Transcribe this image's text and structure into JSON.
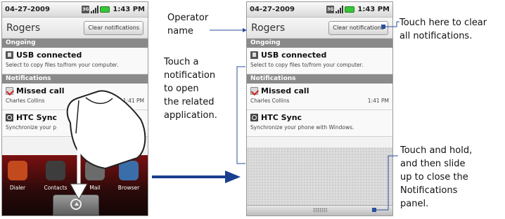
{
  "screens": {
    "status": {
      "date": "04-27-2009",
      "time": "1:43 PM",
      "net_badge": "3G"
    },
    "operator": "Rogers",
    "clear_button_left": "Clear notifications",
    "clear_button_right": "Clear notifications",
    "sections": {
      "ongoing": "Ongoing",
      "notifications": "Notifications"
    },
    "usb": {
      "title": "USB connected",
      "subtitle": "Select to copy files to/from your computer."
    },
    "missed": {
      "title": "Missed call",
      "caller": "Charles Collins",
      "time": "1:41 PM"
    },
    "htc_left": {
      "title": "HTC Sync",
      "subtitle": "Synchronize your p"
    },
    "htc_right": {
      "title": "HTC Sync",
      "subtitle": "Synchronize your phone with Windows."
    },
    "home_apps": [
      "Dialer",
      "Contacts",
      "Mail",
      "Browser"
    ]
  },
  "annotations": {
    "operator": [
      "Operator",
      "name"
    ],
    "touch_notification": [
      "Touch a",
      "notification",
      "to open",
      "the related",
      "application."
    ],
    "clear_all": [
      "Touch here to clear",
      "all notifications."
    ],
    "slide_close": [
      "Touch and hold,",
      "and then slide",
      "up to close the",
      "Notifications",
      "panel."
    ]
  },
  "colors": {
    "arrow": "#1b3f8f",
    "callout_line": "#2a4f9b",
    "section_header": "#8a8a8a"
  }
}
